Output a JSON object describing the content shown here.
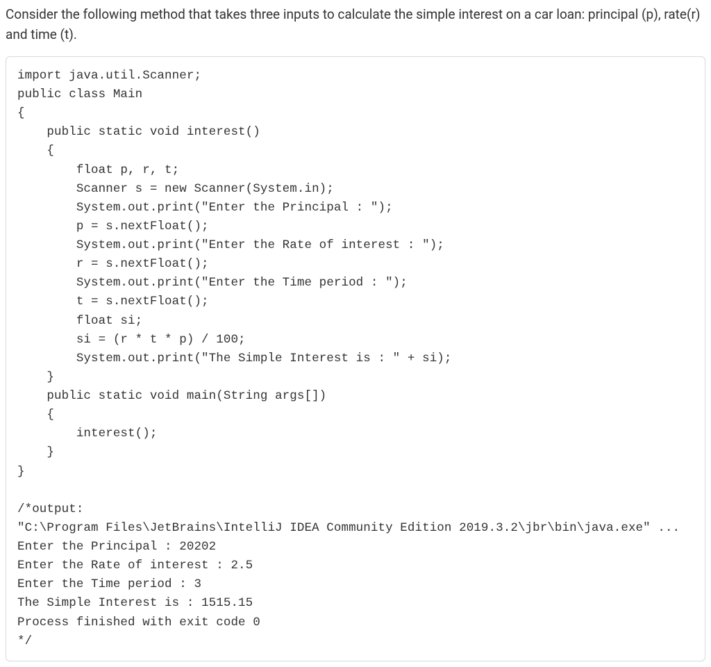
{
  "intro": "Consider the following method that takes three inputs to calculate the simple interest on a car loan: principal (p), rate(r) and time (t).",
  "code_lines": [
    "import java.util.Scanner;",
    "public class Main",
    "{",
    "    public static void interest()",
    "    {",
    "        float p, r, t;",
    "        Scanner s = new Scanner(System.in);",
    "        System.out.print(\"Enter the Principal : \");",
    "        p = s.nextFloat();",
    "        System.out.print(\"Enter the Rate of interest : \");",
    "        r = s.nextFloat();",
    "        System.out.print(\"Enter the Time period : \");",
    "        t = s.nextFloat();",
    "        float si;",
    "        si = (r * t * p) / 100;",
    "        System.out.print(\"The Simple Interest is : \" + si);",
    "    }",
    "    public static void main(String args[])",
    "    {",
    "        interest();",
    "    }",
    "}",
    "",
    "/*output:",
    "\"C:\\Program Files\\JetBrains\\IntelliJ IDEA Community Edition 2019.3.2\\jbr\\bin\\java.exe\" ...",
    "Enter the Principal : 20202",
    "Enter the Rate of interest : 2.5",
    "Enter the Time period : 3",
    "The Simple Interest is : 1515.15",
    "Process finished with exit code 0",
    "*/"
  ]
}
